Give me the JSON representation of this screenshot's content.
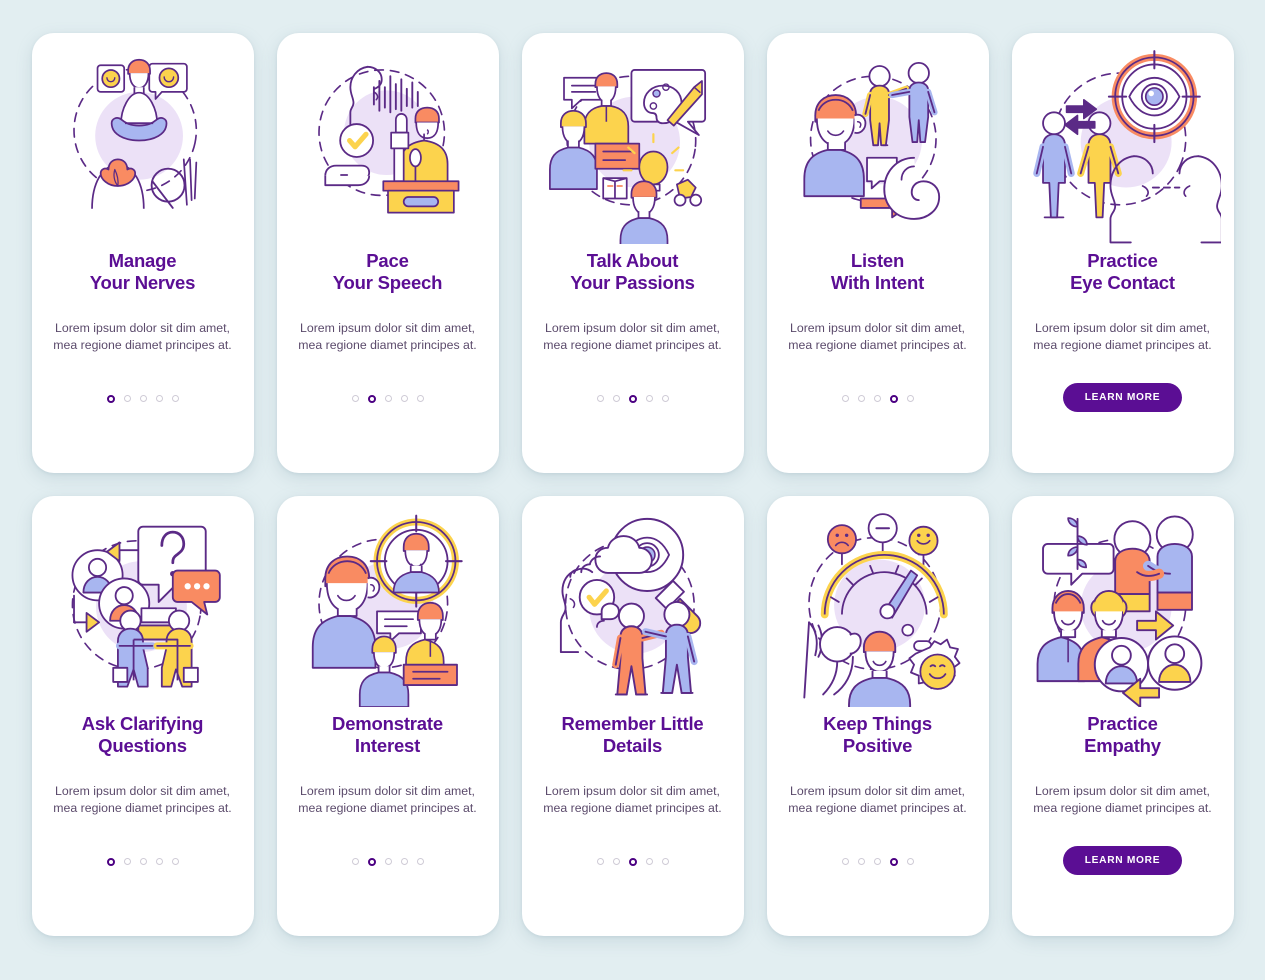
{
  "theme": {
    "background": "#e2eef1",
    "card_background": "#ffffff",
    "title_color": "#5b0e94",
    "body_color": "#5b4a6b",
    "accent_purple": "#5b0e94",
    "dot_inactive": "#cfcbd6",
    "dot_active": "#4b0082",
    "illus_blob": "#ece1f7",
    "stroke": "#5b2a86",
    "yellow": "#fcd34d",
    "orange": "#f98b62",
    "blue": "#9aa8ee",
    "light_blue": "#a8b6f0"
  },
  "body_text": "Lorem ipsum dolor sit dim amet, mea regione diamet principes at.",
  "learn_more_label": "LEARN MORE",
  "cards": [
    {
      "id": "manage-your-nerves",
      "title": "Manage\nYour Nerves",
      "body": "Lorem ipsum dolor sit dim amet, mea regione diamet principes at.",
      "illustration": "meditation-icon",
      "dots": {
        "count": 5,
        "active": 1
      },
      "has_button": false
    },
    {
      "id": "pace-your-speech",
      "title": "Pace\nYour Speech",
      "body": "Lorem ipsum dolor sit dim amet, mea regione diamet principes at.",
      "illustration": "speech-podium-icon",
      "dots": {
        "count": 5,
        "active": 2
      },
      "has_button": false
    },
    {
      "id": "talk-about-your-passions",
      "title": "Talk About\nYour Passions",
      "body": "Lorem ipsum dolor sit dim amet, mea regione diamet principes at.",
      "illustration": "passions-conversation-icon",
      "dots": {
        "count": 5,
        "active": 3
      },
      "has_button": false
    },
    {
      "id": "listen-with-intent",
      "title": "Listen\nWith Intent",
      "body": "Lorem ipsum dolor sit dim amet, mea regione diamet principes at.",
      "illustration": "listening-ear-icon",
      "dots": {
        "count": 5,
        "active": 4
      },
      "has_button": false
    },
    {
      "id": "practice-eye-contact",
      "title": "Practice\nEye Contact",
      "body": "Lorem ipsum dolor sit dim amet, mea regione diamet principes at.",
      "illustration": "eye-contact-target-icon",
      "dots": null,
      "has_button": true,
      "button_label": "LEARN MORE"
    },
    {
      "id": "ask-clarifying-questions",
      "title": "Ask Clarifying\nQuestions",
      "body": "Lorem ipsum dolor sit dim amet, mea regione diamet principes at.",
      "illustration": "question-dialogue-icon",
      "dots": {
        "count": 5,
        "active": 1
      },
      "has_button": false
    },
    {
      "id": "demonstrate-interest",
      "title": "Demonstrate\nInterest",
      "body": "Lorem ipsum dolor sit dim amet, mea regione diamet principes at.",
      "illustration": "interest-target-people-icon",
      "dots": {
        "count": 5,
        "active": 2
      },
      "has_button": false
    },
    {
      "id": "remember-little-details",
      "title": "Remember Little\nDetails",
      "body": "Lorem ipsum dolor sit dim amet, mea regione diamet principes at.",
      "illustration": "magnifier-memory-icon",
      "dots": {
        "count": 5,
        "active": 3
      },
      "has_button": false
    },
    {
      "id": "keep-things-positive",
      "title": "Keep Things\nPositive",
      "body": "Lorem ipsum dolor sit dim amet, mea regione diamet principes at.",
      "illustration": "mood-gauge-icon",
      "dots": {
        "count": 5,
        "active": 4
      },
      "has_button": false
    },
    {
      "id": "practice-empathy",
      "title": "Practice\nEmpathy",
      "body": "Lorem ipsum dolor sit dim amet, mea regione diamet principes at.",
      "illustration": "empathy-exchange-icon",
      "dots": null,
      "has_button": true,
      "button_label": "LEARN MORE"
    }
  ]
}
